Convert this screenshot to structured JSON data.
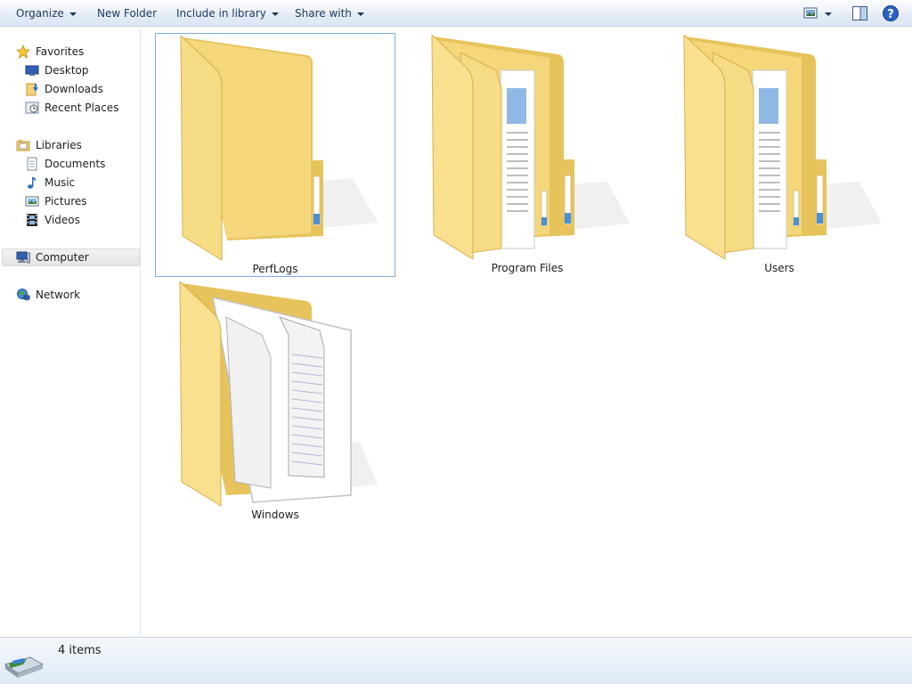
{
  "toolbar": {
    "organize_label": "Organize",
    "new_folder_label": "New Folder",
    "include_label": "Include in library",
    "share_label": "Share with",
    "icons": [
      "view-options-icon",
      "preview-pane-icon",
      "help-icon"
    ]
  },
  "sidebar": {
    "favorites": {
      "label": "Favorites",
      "items": [
        {
          "label": "Desktop",
          "icon": "desktop-icon"
        },
        {
          "label": "Downloads",
          "icon": "downloads-icon"
        },
        {
          "label": "Recent Places",
          "icon": "recent-places-icon"
        }
      ]
    },
    "libraries": {
      "label": "Libraries",
      "items": [
        {
          "label": "Documents",
          "icon": "documents-icon"
        },
        {
          "label": "Music",
          "icon": "music-icon"
        },
        {
          "label": "Pictures",
          "icon": "pictures-icon"
        },
        {
          "label": "Videos",
          "icon": "videos-icon"
        }
      ]
    },
    "computer": {
      "label": "Computer",
      "selected": true
    },
    "network": {
      "label": "Network"
    }
  },
  "content": {
    "folders": [
      {
        "name": "PerfLogs",
        "selected": true,
        "contents": "empty"
      },
      {
        "name": "Program Files",
        "selected": false,
        "contents": "documents"
      },
      {
        "name": "Users",
        "selected": false,
        "contents": "documents"
      },
      {
        "name": "Windows",
        "selected": false,
        "contents": "pages"
      }
    ]
  },
  "statusbar": {
    "item_count": "4 items",
    "icon": "drive-icon"
  },
  "colors": {
    "folder_fill": "#f5d77b",
    "folder_dark": "#e2bb4e",
    "selection_border": "#84acdd",
    "toolbar_text": "#1e395b"
  }
}
